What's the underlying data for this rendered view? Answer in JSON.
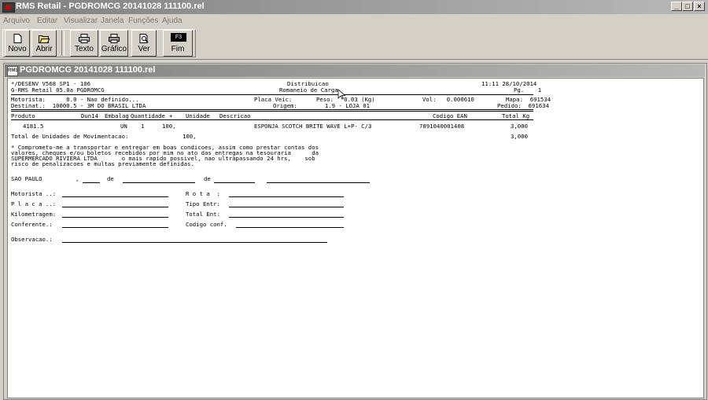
{
  "window": {
    "title": "RMS Retail - PGDROMCG 20141028 111100.rel",
    "min": "_",
    "max": "□",
    "close": "×"
  },
  "menu": [
    "Arquivo",
    "Editar",
    "Visualizar",
    "Janela",
    "Funções",
    "Ajuda"
  ],
  "toolbar": {
    "novo": "Novo",
    "abrir": "Abrir",
    "texto": "Texto",
    "grafico": "Gráfico",
    "ver": "Ver",
    "fim": "Fim",
    "f3": "F3"
  },
  "doc": {
    "title": "PGDROMCG 20141028 111100.rel",
    "icon_text": "RMS"
  },
  "report": {
    "h1_left": "*/DESENV V568 SP1 - 106",
    "h1_center": "Distribuicao",
    "h1_right": "11:11 28/10/2014",
    "h2_left": "G-RMS Retail 05.0a PGDROMCG",
    "h2_center": "Romaneio de Carga",
    "h2_right": "Pg.    1",
    "mot_line": "Motorista:      0.0 - Nao definido...",
    "placa": "Placa Veic:",
    "peso": "Peso:   0.03 (Kg)",
    "vol": "Vol:   0.000610",
    "mapa": "Mapa:  691534",
    "dest_line": "Destinat.:  10000.5 - 3M DO BRASIL LTDA",
    "origem": "Origem:        1.9 - LOJA 01",
    "pedido": "Pedido:  691634",
    "col_produto": "Produto",
    "col_dun": "Dun14",
    "col_emb": "Embalag",
    "col_qtd": "Quantidade",
    "col_plus": "+",
    "col_unid": "Unidade",
    "col_desc": "Descricao",
    "col_ean": "Codigo EAN",
    "col_kg": "Total Kg",
    "item_prod": "4181.5",
    "item_un": "UN",
    "item_emb": "1",
    "item_qtd": "100,",
    "item_desc": "ESPONJA SCOTCH BRITE WAVE L+P- C/3",
    "item_ean": "7891040001408",
    "item_kg": "3,000",
    "tot_label": "Total de Unidades de Movimentacao:",
    "tot_qtd": "100,",
    "tot_kg": "3,000",
    "c1": "* Comprometo-me a transportar e entregar em boas condicoes, assim como prestar contas dos",
    "c2": "valores, cheques e/ou boletos recebidos por mim no ato das entregas na tesouraria      da",
    "c3": "SUPERMERCADO RIVIERA LTDA       o mais rapido possivel, nao ultrapassando 24 hrs,    sob",
    "c4": "risco de penalizacoes e multas previamente definidas.",
    "city": "SAO PAULO",
    "comma": ",",
    "de1": "de",
    "de2": "de",
    "f_mot": "Motorista ..:",
    "f_placa": "P l a c a ..:",
    "f_km": "Kilometragem:",
    "f_conf": "Conferente.:",
    "f_rota": "R o t a  :",
    "f_tipo": "Tipo Entr:",
    "f_total": "Total Ent:",
    "f_codigo": "Codigo conf.",
    "f_obs": "Observacao.:"
  }
}
